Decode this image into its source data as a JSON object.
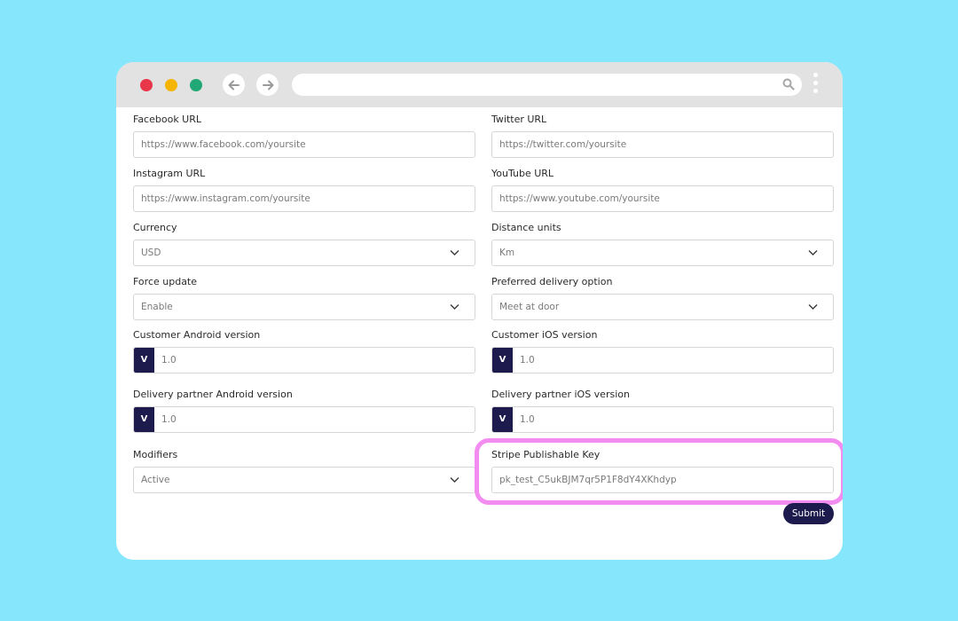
{
  "browser": {
    "address_value": "",
    "icons": [
      "back-arrow-icon",
      "forward-arrow-icon",
      "search-icon",
      "kebab-menu-icon"
    ]
  },
  "form": {
    "facebook": {
      "label": "Facebook URL",
      "value": "https://www.facebook.com/yoursite"
    },
    "twitter": {
      "label": "Twitter URL",
      "value": "https://twitter.com/yoursite"
    },
    "instagram": {
      "label": "Instagram URL",
      "value": "https://www.instagram.com/yoursite"
    },
    "youtube": {
      "label": "YouTube URL",
      "value": "https://www.youtube.com/yoursite"
    },
    "currency": {
      "label": "Currency",
      "value": "USD"
    },
    "distance_units": {
      "label": "Distance units",
      "value": "Km"
    },
    "force_update": {
      "label": "Force update",
      "value": "Enable"
    },
    "preferred_delivery": {
      "label": "Preferred delivery option",
      "value": "Meet at door"
    },
    "customer_android": {
      "label": "Customer Android version",
      "prefix": "V",
      "value": "1.0"
    },
    "customer_ios": {
      "label": "Customer iOS version",
      "prefix": "V",
      "value": "1.0"
    },
    "partner_android": {
      "label": "Delivery partner Android version",
      "prefix": "V",
      "value": "1.0"
    },
    "partner_ios": {
      "label": "Delivery partner iOS version",
      "prefix": "V",
      "value": "1.0"
    },
    "modifiers": {
      "label": "Modifiers",
      "value": "Active"
    },
    "stripe_key": {
      "label": "Stripe Publishable Key",
      "value": "pk_test_C5ukBJM7qr5P1F8dY4XKhdyp"
    },
    "submit_label": "Submit"
  },
  "colors": {
    "background": "#86e6fc",
    "accent_dark": "#1d1a4d",
    "highlight": "#f38cf0"
  }
}
